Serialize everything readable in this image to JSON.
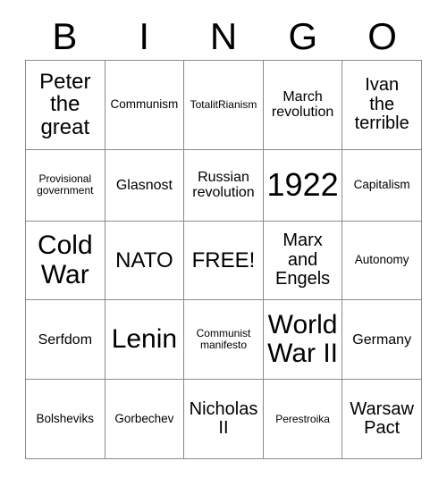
{
  "card": {
    "header_letters": [
      "B",
      "I",
      "N",
      "G",
      "O"
    ],
    "background_color": "#ffffff",
    "border_color": "#8a8a8a",
    "text_color": "#000000",
    "rows": 5,
    "columns": 5
  },
  "grid": {
    "rows": [
      {
        "cells": [
          {
            "text": "Peter\nthe\ngreat",
            "size": "fs-xl"
          },
          {
            "text": "Communism",
            "size": "fs-sm"
          },
          {
            "text": "TotalitRianism",
            "size": "fs-xs"
          },
          {
            "text": "March\nrevolution",
            "size": "fs-md"
          },
          {
            "text": "Ivan\nthe\nterrible",
            "size": "fs-lg"
          }
        ]
      },
      {
        "cells": [
          {
            "text": "Provisional\ngovernment",
            "size": "fs-xs"
          },
          {
            "text": "Glasnost",
            "size": "fs-md"
          },
          {
            "text": "Russian\nrevolution",
            "size": "fs-md"
          },
          {
            "text": "1922",
            "size": "fs-huge"
          },
          {
            "text": "Capitalism",
            "size": "fs-sm"
          }
        ]
      },
      {
        "cells": [
          {
            "text": "Cold\nWar",
            "size": "fs-xxl"
          },
          {
            "text": "NATO",
            "size": "fs-xl"
          },
          {
            "text": "FREE!",
            "size": "fs-xl"
          },
          {
            "text": "Marx\nand\nEngels",
            "size": "fs-lg"
          },
          {
            "text": "Autonomy",
            "size": "fs-sm"
          }
        ]
      },
      {
        "cells": [
          {
            "text": "Serfdom",
            "size": "fs-md"
          },
          {
            "text": "Lenin",
            "size": "fs-xxl"
          },
          {
            "text": "Communist\nmanifesto",
            "size": "fs-xs"
          },
          {
            "text": "World\nWar II",
            "size": "fs-xxl"
          },
          {
            "text": "Germany",
            "size": "fs-md"
          }
        ]
      },
      {
        "cells": [
          {
            "text": "Bolsheviks",
            "size": "fs-sm"
          },
          {
            "text": "Gorbechev",
            "size": "fs-sm"
          },
          {
            "text": "Nicholas\nII",
            "size": "fs-lg"
          },
          {
            "text": "Perestroika",
            "size": "fs-xs"
          },
          {
            "text": "Warsaw\nPact",
            "size": "fs-lg"
          }
        ]
      }
    ]
  }
}
